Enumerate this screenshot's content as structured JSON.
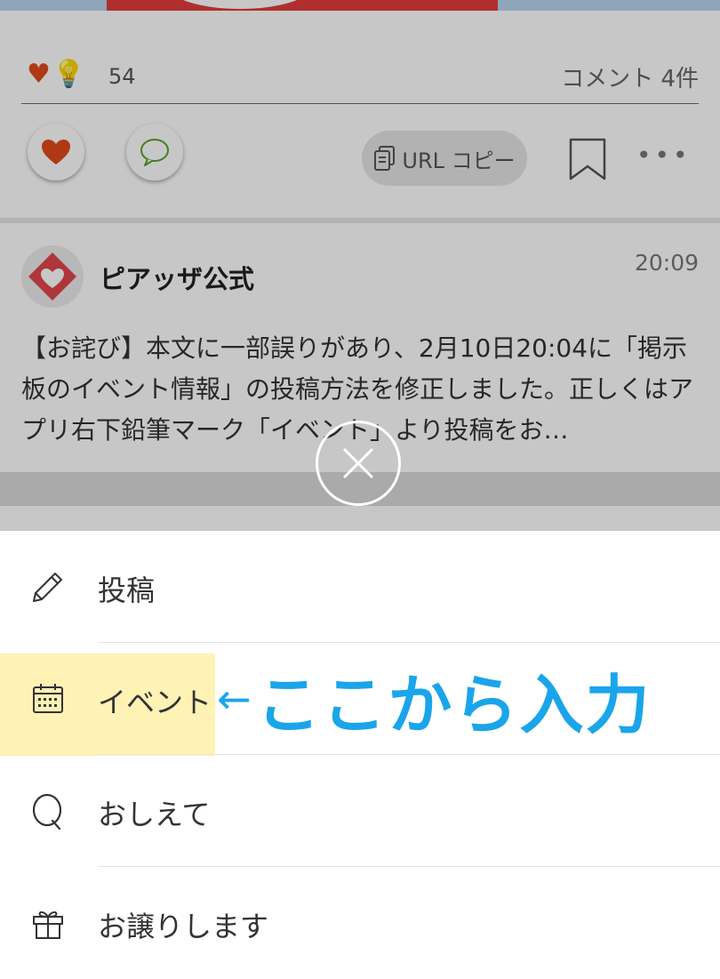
{
  "feed": {
    "like_count": "54",
    "comment_count": "コメント 4件",
    "url_copy_label": "URL コピー",
    "more_label": "•••"
  },
  "post": {
    "author": "ピアッザ公式",
    "time": "20:09",
    "text": "【お詫び】本文に一部誤りがあり、2月10日20:04に「掲示板のイベント情報」の投稿方法を修正しました。正しくはアプリ右下鉛筆マーク「イベント」より投稿をお…"
  },
  "menu": {
    "items": [
      {
        "label": "投稿",
        "icon": "pencil-icon"
      },
      {
        "label": "イベント",
        "icon": "calendar-icon"
      },
      {
        "label": "おしえて",
        "icon": "question-icon"
      },
      {
        "label": "お譲りします",
        "icon": "gift-icon"
      }
    ]
  },
  "annotation": {
    "arrow": "←",
    "text": "ここから入力"
  },
  "colors": {
    "like": "#e04a1a",
    "annotation": "#1aa5ea",
    "highlight": "#ffec96",
    "brand": "#e0474c"
  }
}
